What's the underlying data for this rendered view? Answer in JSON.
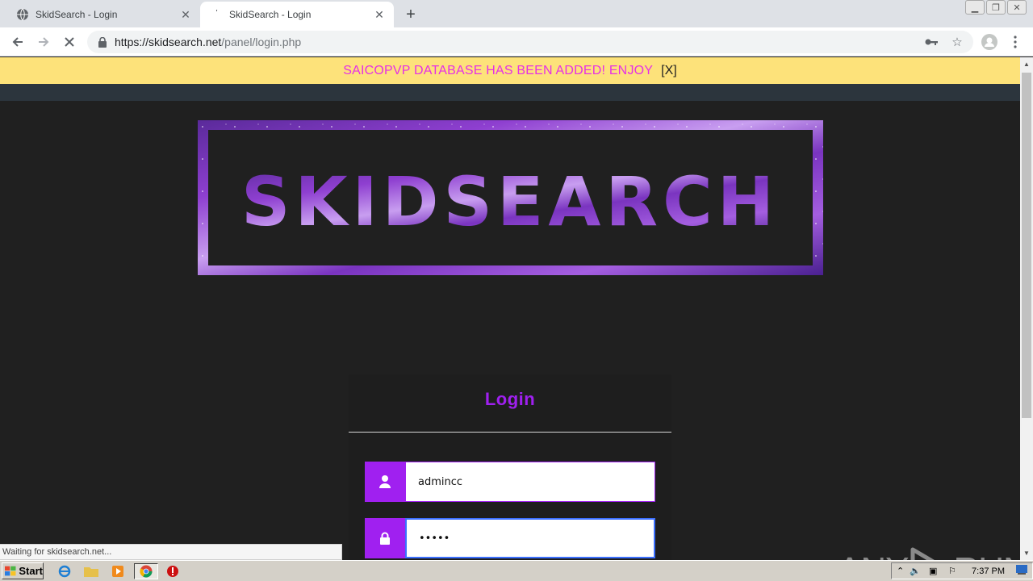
{
  "browser": {
    "tabs": [
      {
        "title": "SkidSearch - Login",
        "active": false
      },
      {
        "title": "SkidSearch - Login",
        "active": true
      }
    ],
    "url_host": "https://skidsearch.net",
    "url_path": "/panel/login.php"
  },
  "page": {
    "banner": {
      "message": "SAICOPVP DATABASE HAS BEEN ADDED! ENJOY",
      "dismiss": "[X]"
    },
    "logo_text": "SKIDSEARCH",
    "login": {
      "title": "Login",
      "username_value": "admincc",
      "password_value": "•••••"
    },
    "status_text": "Waiting for skidsearch.net...",
    "watermark": {
      "left": "ANY",
      "right": "RUN"
    }
  },
  "taskbar": {
    "start_label": "Start",
    "clock": "7:37 PM"
  },
  "colors": {
    "accent_purple": "#a020f0",
    "banner_bg": "#fde27a",
    "banner_text": "#e62fe6",
    "page_bg": "#202020"
  }
}
